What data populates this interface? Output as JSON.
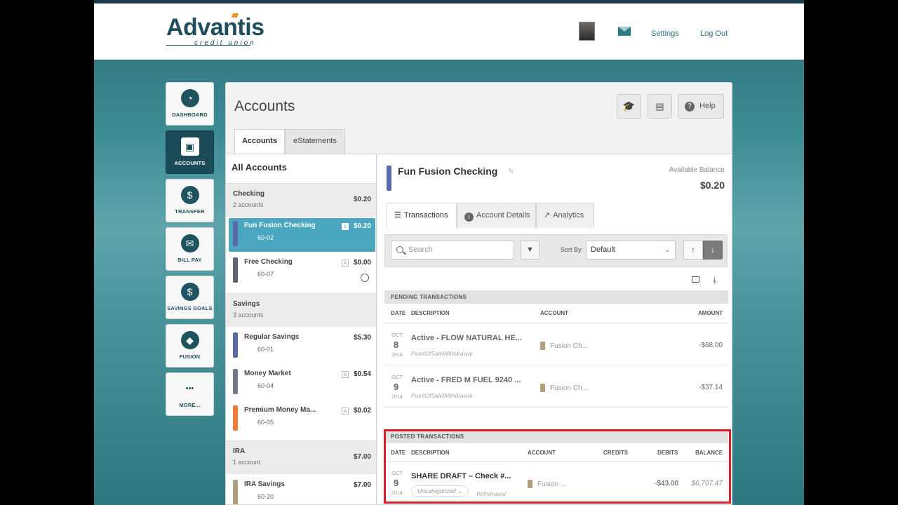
{
  "header": {
    "logo_main": "Advantis",
    "logo_sub": "credit union",
    "settings": "Settings",
    "logout": "Log Out",
    "mail_icon": "mail-icon"
  },
  "nav": [
    {
      "label": "DASHBOARD",
      "icon": "dashboard-icon",
      "glyph": "◔"
    },
    {
      "label": "ACCOUNTS",
      "icon": "wallet-icon",
      "glyph": "▣"
    },
    {
      "label": "TRANSFER",
      "icon": "transfer-icon",
      "glyph": "$"
    },
    {
      "label": "BILL PAY",
      "icon": "envelope-icon",
      "glyph": "✉"
    },
    {
      "label": "SAVINGS GOALS",
      "icon": "piggy-bank-icon",
      "glyph": "$"
    },
    {
      "label": "FUSION",
      "icon": "fusion-icon",
      "glyph": "◆"
    },
    {
      "label": "MORE...",
      "icon": "more-icon",
      "glyph": "•••"
    }
  ],
  "page": {
    "title": "Accounts",
    "help": "Help",
    "tabs": [
      "Accounts",
      "eStatements"
    ]
  },
  "accounts": {
    "heading": "All Accounts",
    "groups": [
      {
        "name": "Checking",
        "count": "2 accounts",
        "balance": "$0.20"
      },
      {
        "name": "Savings",
        "count": "3 accounts",
        "balance": ""
      },
      {
        "name": "IRA",
        "count": "1 account",
        "balance": "$7.00"
      }
    ],
    "items": [
      {
        "name": "Fun Fusion Checking",
        "number": "60-02",
        "balance": "$0.20",
        "badge": "A",
        "color": "#5a6aa8"
      },
      {
        "name": "Free Checking",
        "number": "60-07",
        "balance": "$0.00",
        "badge": "A",
        "color": "#5d6570"
      },
      {
        "name": "Regular Savings",
        "number": "60-01",
        "balance": "$5.30",
        "badge": "",
        "color": "#5a6aa8"
      },
      {
        "name": "Money Market",
        "number": "60-04",
        "balance": "$0.54",
        "badge": "A",
        "color": "#737a86"
      },
      {
        "name": "Premium Money Ma...",
        "number": "60-05",
        "balance": "$0.02",
        "badge": "A",
        "color": "#f07a3a"
      },
      {
        "name": "IRA Savings",
        "number": "60-20",
        "balance": "$7.00",
        "badge": "",
        "color": "#b09e7d"
      }
    ]
  },
  "detail": {
    "title": "Fun Fusion Checking",
    "available_label": "Available Balance",
    "available_value": "$0.20",
    "tabs": [
      "Transactions",
      "Account Details",
      "Analytics"
    ],
    "search_placeholder": "Search",
    "sort_label": "Sort By:",
    "sort_value": "Default"
  },
  "pending": {
    "title": "PENDING TRANSACTIONS",
    "columns": [
      "DATE",
      "DESCRIPTION",
      "ACCOUNT",
      "AMOUNT"
    ],
    "rows": [
      {
        "month": "OCT",
        "day": "8",
        "year": "2014",
        "desc": "Active - FLOW NATURAL HE...",
        "sub": "PointOfSaleWithdrawal",
        "account": "Fusion Ch...",
        "amount": "-$68.00"
      },
      {
        "month": "OCT",
        "day": "9",
        "year": "2014",
        "desc": "Active - FRED M FUEL 9240 ...",
        "sub": "PointOfSaleWithdrawal",
        "account": "Fusion Ch...",
        "amount": "-$37.14"
      }
    ]
  },
  "posted": {
    "title": "POSTED TRANSACTIONS",
    "columns": [
      "DATE",
      "DESCRIPTION",
      "ACCOUNT",
      "CREDITS",
      "DEBITS",
      "BALANCE"
    ],
    "rows": [
      {
        "month": "OCT",
        "day": "9",
        "year": "2014",
        "desc": "SHARE DRAFT – Check #...",
        "category": "Uncategorized",
        "type": "Withdrawal",
        "account": "Fusion ...",
        "credits": "",
        "debits": "-$43.00",
        "balance": "$6,707.47"
      }
    ]
  }
}
